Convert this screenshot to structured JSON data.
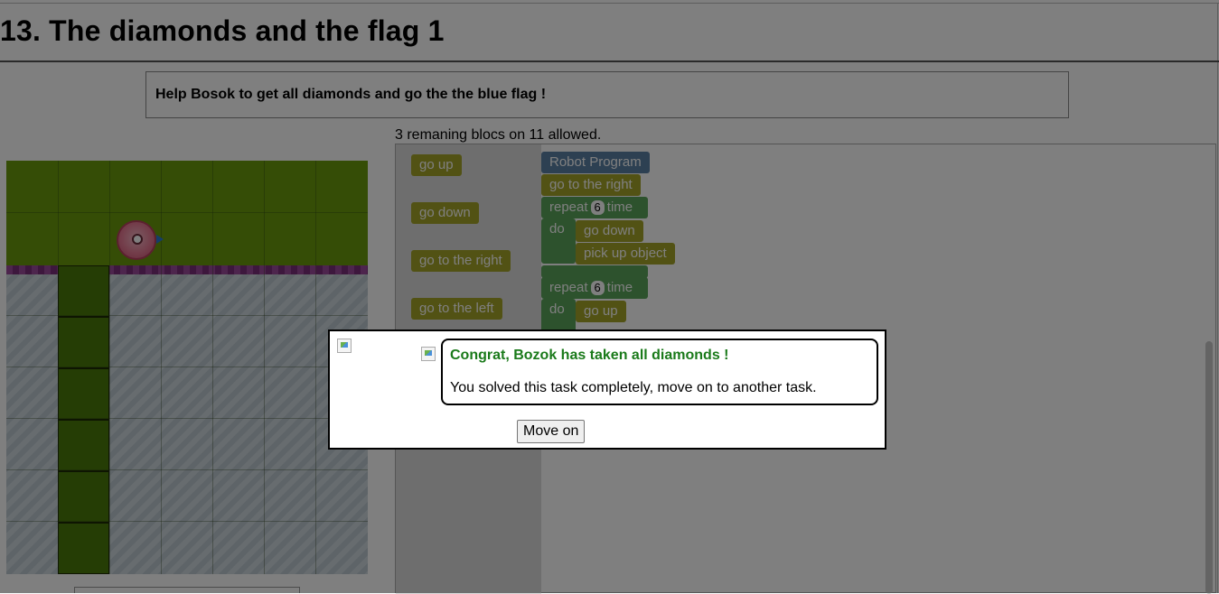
{
  "title": "13. The diamonds and the flag 1",
  "instructions": "Help Bosok to get all diamonds and go the the blue flag !",
  "remaining": "3 remaning blocs on 11 allowed.",
  "toolbox": [
    "go up",
    "go down",
    "go to the right",
    "go to the left"
  ],
  "program": {
    "start": "Robot Program",
    "first_move": "go to the right",
    "repeat_word": "repeat",
    "time_word": "time",
    "do_word": "do",
    "loop1": {
      "count": "6",
      "moves": [
        "go down",
        "pick up object"
      ]
    },
    "loop2": {
      "count": "6",
      "moves": [
        "go up"
      ]
    }
  },
  "dialog": {
    "title": "Congrat, Bozok has taken all diamonds !",
    "message": "You solved this task completely, move on to another task.",
    "button": "Move on"
  },
  "colors": {
    "success": "#1a7a1a",
    "move_block": "#a5a529",
    "loop_block": "#5ba55b",
    "program_block": "#5b80a5"
  }
}
